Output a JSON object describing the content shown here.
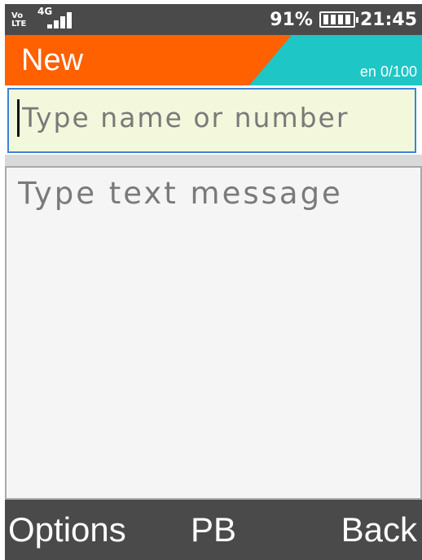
{
  "status_bar": {
    "volte_top": "Vo",
    "volte_bottom": "LTE",
    "network_type": "4G",
    "signal_icon": "signal-bars-icon",
    "battery_percent": "91%",
    "battery_icon": "battery-icon",
    "battery_level": 0.91,
    "time": "21:45"
  },
  "header": {
    "title": "New",
    "counter": "en 0/100",
    "accent_orange": "#ff6000",
    "accent_teal": "#1ec6c6"
  },
  "recipient": {
    "placeholder": "Type name or number",
    "value": ""
  },
  "message": {
    "placeholder": "Type text message",
    "value": ""
  },
  "softkeys": {
    "left": "Options",
    "center": "PB",
    "right": "Back"
  }
}
